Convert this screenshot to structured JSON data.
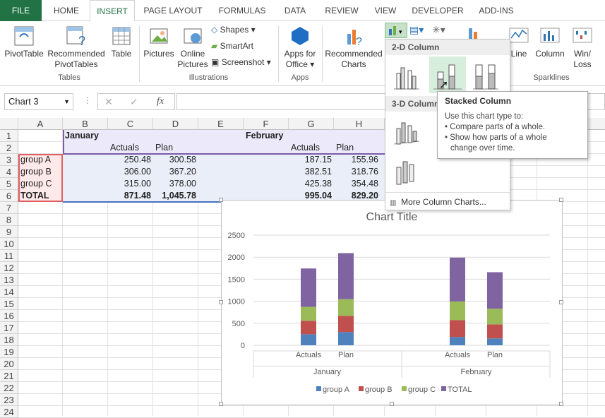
{
  "tabs": [
    "FILE",
    "HOME",
    "INSERT",
    "PAGE LAYOUT",
    "FORMULAS",
    "DATA",
    "REVIEW",
    "VIEW",
    "DEVELOPER",
    "ADD-INS"
  ],
  "ribbon": {
    "tables": {
      "pivot": "PivotTable",
      "rec_pivot": [
        "Recommended",
        "PivotTables"
      ],
      "table": "Table",
      "group": "Tables"
    },
    "illustrations": {
      "pictures": "Pictures",
      "online": [
        "Online",
        "Pictures"
      ],
      "shapes": "Shapes",
      "smartart": "SmartArt",
      "screenshot": "Screenshot",
      "group": "Illustrations"
    },
    "apps": {
      "apps_office": [
        "Apps for",
        "Office"
      ],
      "group": "Apps"
    },
    "charts": {
      "recommended": [
        "Recommended",
        "Charts"
      ]
    },
    "sparklines": {
      "line": "Line",
      "column": "Column",
      "winloss": [
        "Win/",
        "Loss"
      ],
      "group": "Sparklines"
    }
  },
  "namebox": "Chart 3",
  "fx": "fx",
  "columns": [
    "A",
    "B",
    "C",
    "D",
    "E",
    "F",
    "G",
    "H"
  ],
  "rows": [
    "1",
    "2",
    "3",
    "4",
    "5",
    "6",
    "7",
    "8",
    "9",
    "10",
    "11",
    "12",
    "13",
    "14",
    "15",
    "16",
    "17",
    "18",
    "19",
    "20",
    "21",
    "22",
    "23",
    "24"
  ],
  "sheet": {
    "jan": "January",
    "feb": "February",
    "actuals": "Actuals",
    "plan": "Plan",
    "rows": [
      {
        "label": "group A",
        "c": "250.48",
        "d": "300.58",
        "g": "187.15",
        "h": "155.96"
      },
      {
        "label": "group B",
        "c": "306.00",
        "d": "367.20",
        "g": "382.51",
        "h": "318.76"
      },
      {
        "label": "group C",
        "c": "315.00",
        "d": "378.00",
        "g": "425.38",
        "h": "354.48"
      },
      {
        "label": "TOTAL",
        "c": "871.48",
        "d": "1,045.78",
        "g": "995.04",
        "h": "829.20"
      }
    ]
  },
  "dropdown": {
    "h2d": "2-D Column",
    "h3d": "3-D Column",
    "more": "More Column Charts..."
  },
  "tooltip": {
    "title": "Stacked Column",
    "intro": "Use this chart type to:",
    "b1": "• Compare parts of a whole.",
    "b2": "• Show how parts of a whole",
    "b3": "change over time."
  },
  "colors": {
    "excel_green": "#217346",
    "s1": "#4f81bd",
    "s2": "#c0504d",
    "s3": "#9bbb59",
    "s4": "#8064a2"
  },
  "chart_data": {
    "type": "bar",
    "stacked": true,
    "title": "Chart Title",
    "groups": [
      {
        "name": "January",
        "cats": [
          "Actuals",
          "Plan"
        ]
      },
      {
        "name": "February",
        "cats": [
          "Actuals",
          "Plan"
        ]
      }
    ],
    "series": [
      {
        "name": "group A",
        "values": [
          250.48,
          300.58,
          187.15,
          155.96
        ]
      },
      {
        "name": "group B",
        "values": [
          306.0,
          367.2,
          382.51,
          318.76
        ]
      },
      {
        "name": "group C",
        "values": [
          315.0,
          378.0,
          425.38,
          354.48
        ]
      },
      {
        "name": "TOTAL",
        "values": [
          871.48,
          1045.78,
          995.04,
          829.2
        ]
      }
    ],
    "yticks": [
      "0",
      "500",
      "1000",
      "1500",
      "2000",
      "2500"
    ],
    "ylim": [
      0,
      2500
    ],
    "legend": "bottom",
    "grid": true
  }
}
